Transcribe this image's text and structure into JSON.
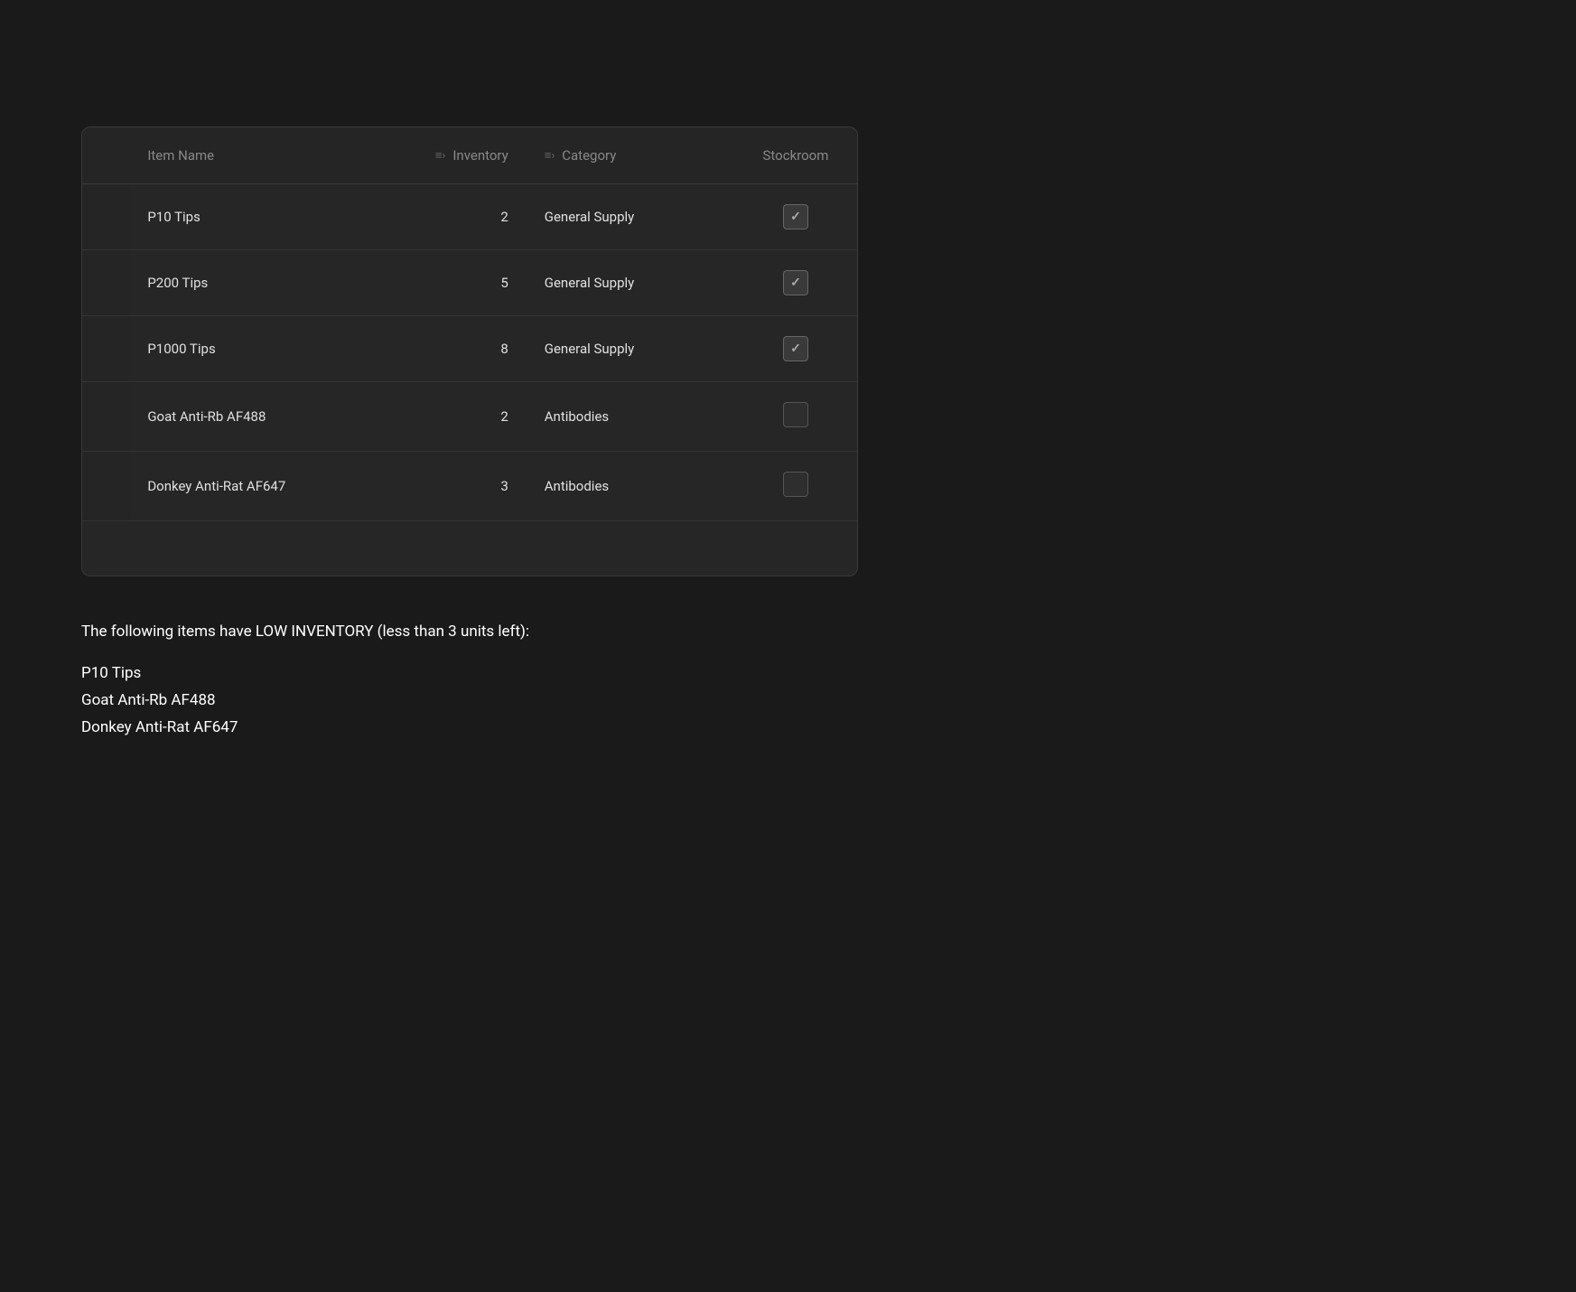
{
  "table": {
    "columns": [
      {
        "key": "select",
        "label": ""
      },
      {
        "key": "name",
        "label": "Item Name"
      },
      {
        "key": "inventory",
        "label": "Inventory",
        "icon": "sort-icon"
      },
      {
        "key": "category",
        "label": "Category",
        "icon": "sort-icon"
      },
      {
        "key": "stockroom",
        "label": "Stockroom"
      }
    ],
    "rows": [
      {
        "name": "P10 Tips",
        "inventory": "2",
        "category": "General Supply",
        "stockroom": true
      },
      {
        "name": "P200 Tips",
        "inventory": "5",
        "category": "General Supply",
        "stockroom": true
      },
      {
        "name": "P1000 Tips",
        "inventory": "8",
        "category": "General Supply",
        "stockroom": true
      },
      {
        "name": "Goat Anti-Rb AF488",
        "inventory": "2",
        "category": "Antibodies",
        "stockroom": false
      },
      {
        "name": "Donkey Anti-Rat AF647",
        "inventory": "3",
        "category": "Antibodies",
        "stockroom": false
      }
    ]
  },
  "low_inventory": {
    "title": "The following items have LOW INVENTORY (less than 3 units left):",
    "items": [
      "P10 Tips",
      "Goat Anti-Rb AF488",
      "Donkey Anti-Rat AF647"
    ]
  }
}
